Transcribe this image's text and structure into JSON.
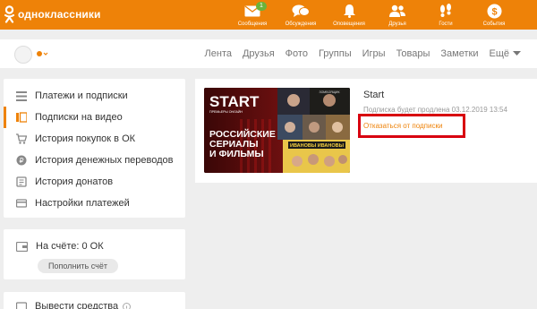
{
  "brand": {
    "name": "одноклассники",
    "color": "#ee8208"
  },
  "top_nav": [
    {
      "label": "Сообщения",
      "icon": "envelope-icon",
      "badge": "1"
    },
    {
      "label": "Обсуждения",
      "icon": "chat-bubbles-icon"
    },
    {
      "label": "Оповещения",
      "icon": "bell-icon"
    },
    {
      "label": "Друзья",
      "icon": "friends-icon"
    },
    {
      "label": "Гости",
      "icon": "footprints-icon"
    },
    {
      "label": "События",
      "icon": "dollar-coin-icon"
    }
  ],
  "sub_nav": [
    "Лента",
    "Друзья",
    "Фото",
    "Группы",
    "Игры",
    "Товары",
    "Заметки",
    "Ещё"
  ],
  "sidebar": {
    "items": [
      {
        "label": "Платежи и подписки",
        "icon": "list-icon"
      },
      {
        "label": "Подписки на видео",
        "icon": "video-subscription-icon",
        "active": true
      },
      {
        "label": "История покупок в ОК",
        "icon": "cart-icon"
      },
      {
        "label": "История денежных переводов",
        "icon": "money-transfer-icon"
      },
      {
        "label": "История донатов",
        "icon": "donation-icon"
      },
      {
        "label": "Настройки платежей",
        "icon": "settings-card-icon"
      }
    ],
    "balance_label": "На счёте: 0 ОК",
    "topup_label": "Пополнить счёт",
    "withdraw_label": "Вывести средства"
  },
  "subscription": {
    "title": "Start",
    "renew_text": "Подписка будет продлена 03.12.2019 13:54",
    "cancel_label": "Отказаться от подписки",
    "banner": {
      "logo": "START",
      "tagline": "ПРЕМЬЕРЫ ОНЛАЙН",
      "headline_lines": [
        "РОССИЙСКИЕ",
        "СЕРИАЛЫ",
        "И ФИЛЬМЫ"
      ],
      "show_title": "ИВАНОВЫ ИВАНОВЫ",
      "corner_text": "ЗОМБОЯЩИК"
    }
  },
  "highlight_color": "#d8000f"
}
